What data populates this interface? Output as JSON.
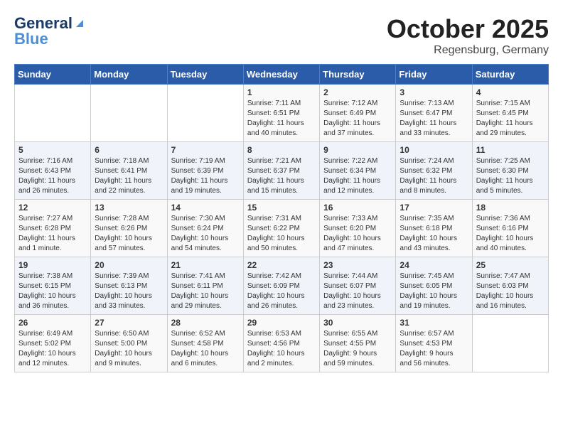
{
  "header": {
    "logo_general": "General",
    "logo_blue": "Blue",
    "title": "October 2025",
    "subtitle": "Regensburg, Germany"
  },
  "weekdays": [
    "Sunday",
    "Monday",
    "Tuesday",
    "Wednesday",
    "Thursday",
    "Friday",
    "Saturday"
  ],
  "weeks": [
    [
      {
        "day": "",
        "info": ""
      },
      {
        "day": "",
        "info": ""
      },
      {
        "day": "",
        "info": ""
      },
      {
        "day": "1",
        "info": "Sunrise: 7:11 AM\nSunset: 6:51 PM\nDaylight: 11 hours\nand 40 minutes."
      },
      {
        "day": "2",
        "info": "Sunrise: 7:12 AM\nSunset: 6:49 PM\nDaylight: 11 hours\nand 37 minutes."
      },
      {
        "day": "3",
        "info": "Sunrise: 7:13 AM\nSunset: 6:47 PM\nDaylight: 11 hours\nand 33 minutes."
      },
      {
        "day": "4",
        "info": "Sunrise: 7:15 AM\nSunset: 6:45 PM\nDaylight: 11 hours\nand 29 minutes."
      }
    ],
    [
      {
        "day": "5",
        "info": "Sunrise: 7:16 AM\nSunset: 6:43 PM\nDaylight: 11 hours\nand 26 minutes."
      },
      {
        "day": "6",
        "info": "Sunrise: 7:18 AM\nSunset: 6:41 PM\nDaylight: 11 hours\nand 22 minutes."
      },
      {
        "day": "7",
        "info": "Sunrise: 7:19 AM\nSunset: 6:39 PM\nDaylight: 11 hours\nand 19 minutes."
      },
      {
        "day": "8",
        "info": "Sunrise: 7:21 AM\nSunset: 6:37 PM\nDaylight: 11 hours\nand 15 minutes."
      },
      {
        "day": "9",
        "info": "Sunrise: 7:22 AM\nSunset: 6:34 PM\nDaylight: 11 hours\nand 12 minutes."
      },
      {
        "day": "10",
        "info": "Sunrise: 7:24 AM\nSunset: 6:32 PM\nDaylight: 11 hours\nand 8 minutes."
      },
      {
        "day": "11",
        "info": "Sunrise: 7:25 AM\nSunset: 6:30 PM\nDaylight: 11 hours\nand 5 minutes."
      }
    ],
    [
      {
        "day": "12",
        "info": "Sunrise: 7:27 AM\nSunset: 6:28 PM\nDaylight: 11 hours\nand 1 minute."
      },
      {
        "day": "13",
        "info": "Sunrise: 7:28 AM\nSunset: 6:26 PM\nDaylight: 10 hours\nand 57 minutes."
      },
      {
        "day": "14",
        "info": "Sunrise: 7:30 AM\nSunset: 6:24 PM\nDaylight: 10 hours\nand 54 minutes."
      },
      {
        "day": "15",
        "info": "Sunrise: 7:31 AM\nSunset: 6:22 PM\nDaylight: 10 hours\nand 50 minutes."
      },
      {
        "day": "16",
        "info": "Sunrise: 7:33 AM\nSunset: 6:20 PM\nDaylight: 10 hours\nand 47 minutes."
      },
      {
        "day": "17",
        "info": "Sunrise: 7:35 AM\nSunset: 6:18 PM\nDaylight: 10 hours\nand 43 minutes."
      },
      {
        "day": "18",
        "info": "Sunrise: 7:36 AM\nSunset: 6:16 PM\nDaylight: 10 hours\nand 40 minutes."
      }
    ],
    [
      {
        "day": "19",
        "info": "Sunrise: 7:38 AM\nSunset: 6:15 PM\nDaylight: 10 hours\nand 36 minutes."
      },
      {
        "day": "20",
        "info": "Sunrise: 7:39 AM\nSunset: 6:13 PM\nDaylight: 10 hours\nand 33 minutes."
      },
      {
        "day": "21",
        "info": "Sunrise: 7:41 AM\nSunset: 6:11 PM\nDaylight: 10 hours\nand 29 minutes."
      },
      {
        "day": "22",
        "info": "Sunrise: 7:42 AM\nSunset: 6:09 PM\nDaylight: 10 hours\nand 26 minutes."
      },
      {
        "day": "23",
        "info": "Sunrise: 7:44 AM\nSunset: 6:07 PM\nDaylight: 10 hours\nand 23 minutes."
      },
      {
        "day": "24",
        "info": "Sunrise: 7:45 AM\nSunset: 6:05 PM\nDaylight: 10 hours\nand 19 minutes."
      },
      {
        "day": "25",
        "info": "Sunrise: 7:47 AM\nSunset: 6:03 PM\nDaylight: 10 hours\nand 16 minutes."
      }
    ],
    [
      {
        "day": "26",
        "info": "Sunrise: 6:49 AM\nSunset: 5:02 PM\nDaylight: 10 hours\nand 12 minutes."
      },
      {
        "day": "27",
        "info": "Sunrise: 6:50 AM\nSunset: 5:00 PM\nDaylight: 10 hours\nand 9 minutes."
      },
      {
        "day": "28",
        "info": "Sunrise: 6:52 AM\nSunset: 4:58 PM\nDaylight: 10 hours\nand 6 minutes."
      },
      {
        "day": "29",
        "info": "Sunrise: 6:53 AM\nSunset: 4:56 PM\nDaylight: 10 hours\nand 2 minutes."
      },
      {
        "day": "30",
        "info": "Sunrise: 6:55 AM\nSunset: 4:55 PM\nDaylight: 9 hours\nand 59 minutes."
      },
      {
        "day": "31",
        "info": "Sunrise: 6:57 AM\nSunset: 4:53 PM\nDaylight: 9 hours\nand 56 minutes."
      },
      {
        "day": "",
        "info": ""
      }
    ]
  ]
}
